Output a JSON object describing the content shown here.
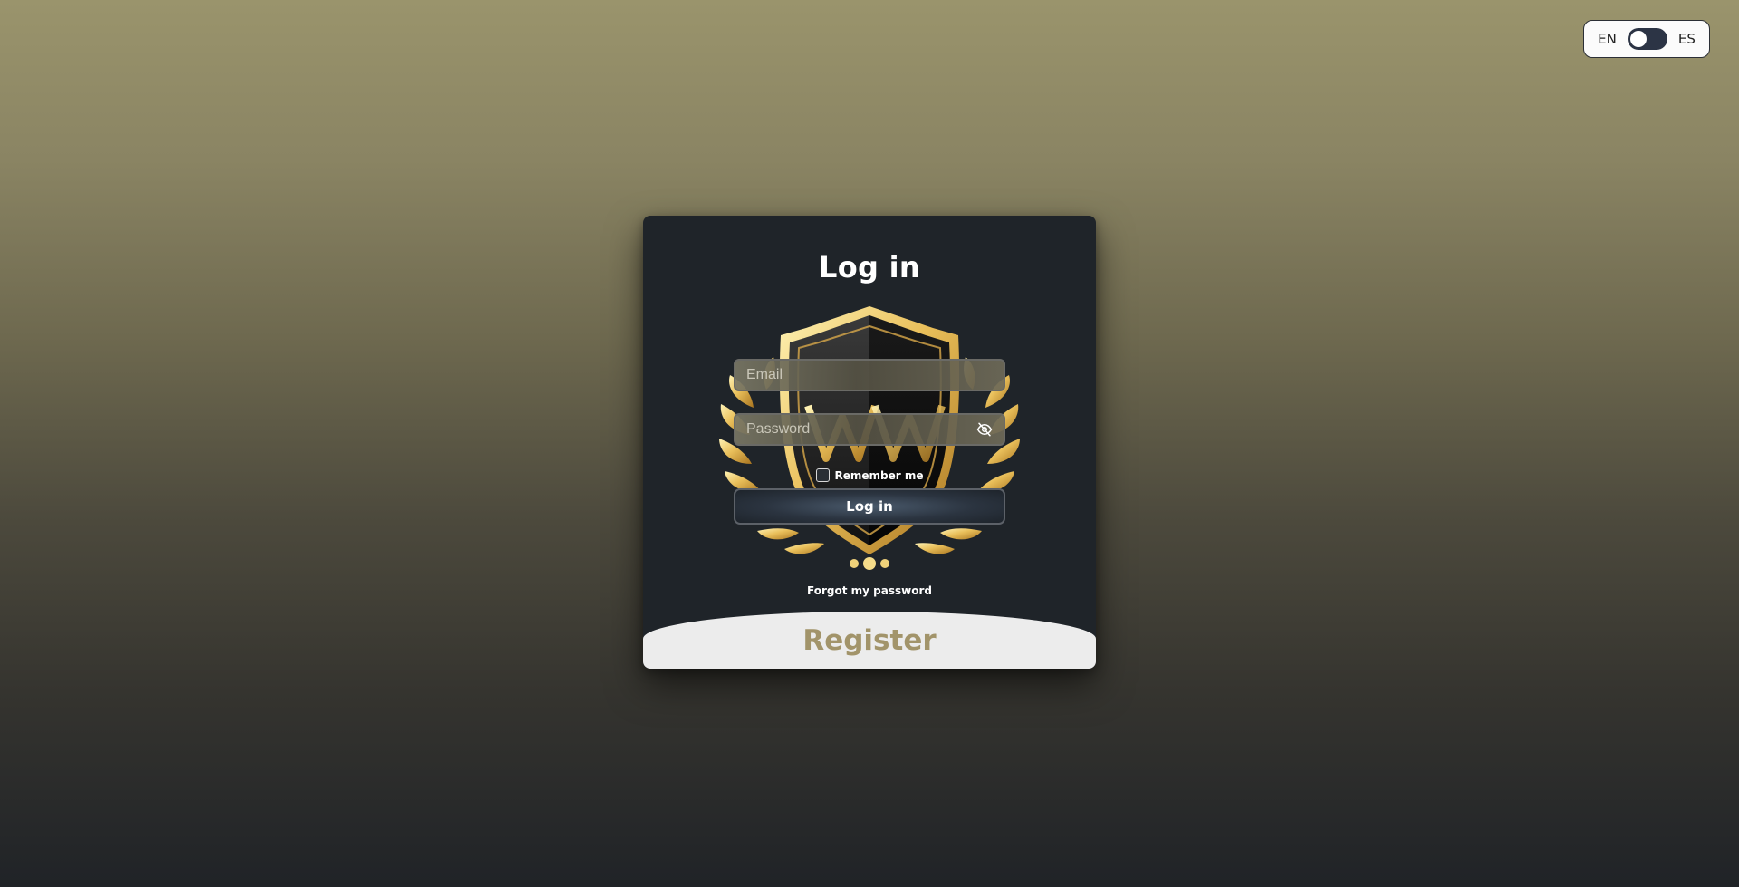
{
  "language_toggle": {
    "left_label": "EN",
    "right_label": "ES",
    "selected": "EN"
  },
  "login_card": {
    "title": "Log in",
    "emblem_icon": "golden-shield-laurel-emblem",
    "email": {
      "placeholder": "Email",
      "value": ""
    },
    "password": {
      "placeholder": "Password",
      "value": "",
      "visibility_icon": "eye-slash-icon"
    },
    "remember_me": {
      "label": "Remember me",
      "checked": false
    },
    "submit_label": "Log in",
    "forgot_password_label": "Forgot my password",
    "register_label": "Register"
  },
  "colors": {
    "background_top": "#9a946c",
    "background_bottom": "#202327",
    "card": "#1f2429",
    "register_text": "#a2946a",
    "register_bg": "#ececec"
  }
}
